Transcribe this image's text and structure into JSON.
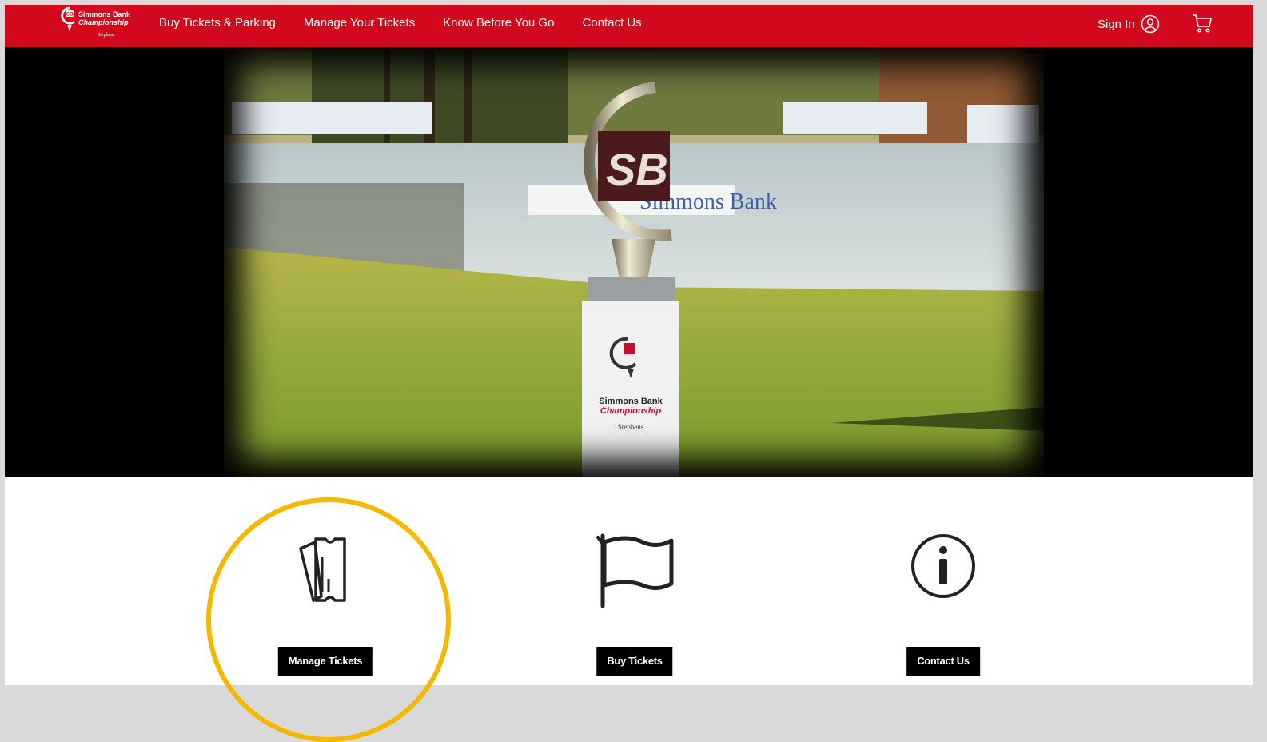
{
  "colors": {
    "brand_red": "#d2091c",
    "button_bg": "#000000",
    "highlight": "#f5b800",
    "outer_bg": "#d9d9d9"
  },
  "logo": {
    "line1": "Simmons Bank",
    "line2": "Championship",
    "line3": "Stephens"
  },
  "nav": {
    "items": [
      "Buy Tickets & Parking",
      "Manage Your Tickets",
      "Know Before You Go",
      "Contact Us"
    ]
  },
  "header": {
    "sign_in": "Sign In",
    "user_icon": "user-circle-icon",
    "cart_icon": "cart-icon"
  },
  "hero": {
    "alt": "Trophy on display at the golf course",
    "pedestal_line1": "Simmons Bank",
    "pedestal_line2": "Championship",
    "pedestal_line3": "Stephens",
    "banner_text": "Simmons Bank"
  },
  "cards": [
    {
      "icon": "ticket-icon",
      "label": "Manage Tickets",
      "highlighted": true
    },
    {
      "icon": "flag-icon",
      "label": "Buy Tickets",
      "highlighted": false
    },
    {
      "icon": "info-icon",
      "label": "Contact Us",
      "highlighted": false
    }
  ]
}
